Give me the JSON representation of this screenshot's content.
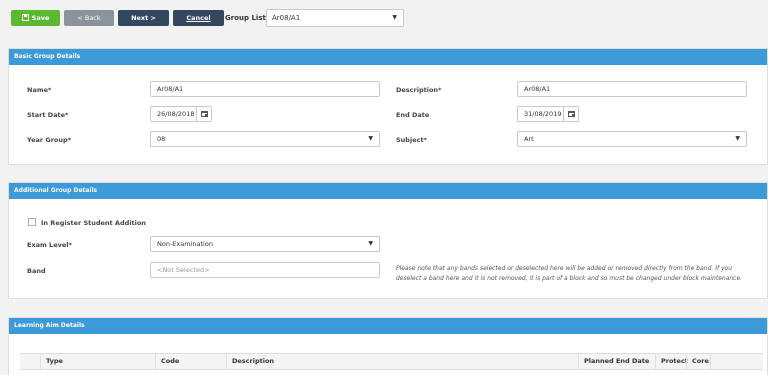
{
  "toolbar": {
    "save_label": "Save",
    "back_label": "< Back",
    "next_label": "Next >",
    "cancel_label": "Cancel",
    "group_list_label": "Group List:",
    "group_list_value": "Ar08/A1"
  },
  "basic": {
    "header": "Basic Group Details",
    "name_label": "Name*",
    "name_value": "Ar08/A1",
    "description_label": "Description*",
    "description_value": "Ar08/A1",
    "start_label": "Start Date*",
    "start_value": "26/08/2018",
    "end_label": "End Date",
    "end_value": "31/08/2019",
    "year_label": "Year Group*",
    "year_value": "08",
    "subject_label": "Subject*",
    "subject_value": "Art"
  },
  "additional": {
    "header": "Additional Group Details",
    "register_label": "In Register Student Addition",
    "register_checked": false,
    "exam_label": "Exam Level*",
    "exam_value": "Non-Examination",
    "band_label": "Band",
    "band_placeholder": "<Not Selected>",
    "note": "Please note that any bands selected or deselected here will be added or removed directly from the band. If you deselect a band here and it is not removed, it is part of a block and so must be changed under block maintenance."
  },
  "learning": {
    "header": "Learning Aim Details",
    "columns": [
      "Type",
      "Code",
      "Description",
      "Planned End Date",
      "Protect",
      "Core"
    ]
  },
  "colors": {
    "save": "#5cb82e",
    "back": "#8a9399",
    "dark": "#33475f",
    "header": "#3d9ad8"
  },
  "icons": {
    "save": "save-icon",
    "calendar": "calendar-icon",
    "dropdown": "chevron-down-icon"
  }
}
